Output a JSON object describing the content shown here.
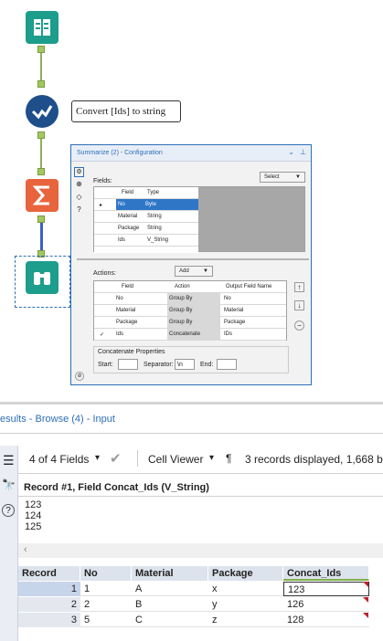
{
  "canvas": {
    "annotation": "Convert [Ids] to string"
  },
  "config": {
    "title": "Summarize (2) - Configuration",
    "fields_label": "Fields:",
    "select_label": "Select",
    "fields_header": [
      "Field",
      "Type"
    ],
    "fields": [
      [
        "No",
        "Byte"
      ],
      [
        "Material",
        "String"
      ],
      [
        "Package",
        "String"
      ],
      [
        "Ids",
        "V_String"
      ]
    ],
    "actions_label": "Actions:",
    "add_label": "Add",
    "actions_header": [
      "Field",
      "Action",
      "Output Field Name"
    ],
    "actions": [
      [
        "No",
        "Group By",
        "No"
      ],
      [
        "Material",
        "Group By",
        "Material"
      ],
      [
        "Package",
        "Group By",
        "Package"
      ],
      [
        "Ids",
        "Concatenate",
        "IDs"
      ]
    ],
    "concat_title": "Concatenate Properties",
    "start_label": "Start:",
    "separator_label": "Separator:",
    "separator_value": "\\n",
    "end_label": "End:"
  },
  "results": {
    "title": "esults - Browse (4) - Input",
    "fields_count": "4 of 4 Fields",
    "cell_viewer": "Cell Viewer",
    "paragraph": "¶",
    "records_info": "3 records displayed, 1,668 by",
    "record_title": "Record #1, Field Concat_Ids (V_String)",
    "record_lines": [
      "123",
      "124",
      "125"
    ],
    "columns": [
      "Record",
      "No",
      "Material",
      "Package",
      "Concat_Ids"
    ],
    "rows": [
      [
        "1",
        "1",
        "A",
        "x",
        "123"
      ],
      [
        "2",
        "2",
        "B",
        "y",
        "126"
      ],
      [
        "3",
        "5",
        "C",
        "z",
        "128"
      ]
    ]
  }
}
